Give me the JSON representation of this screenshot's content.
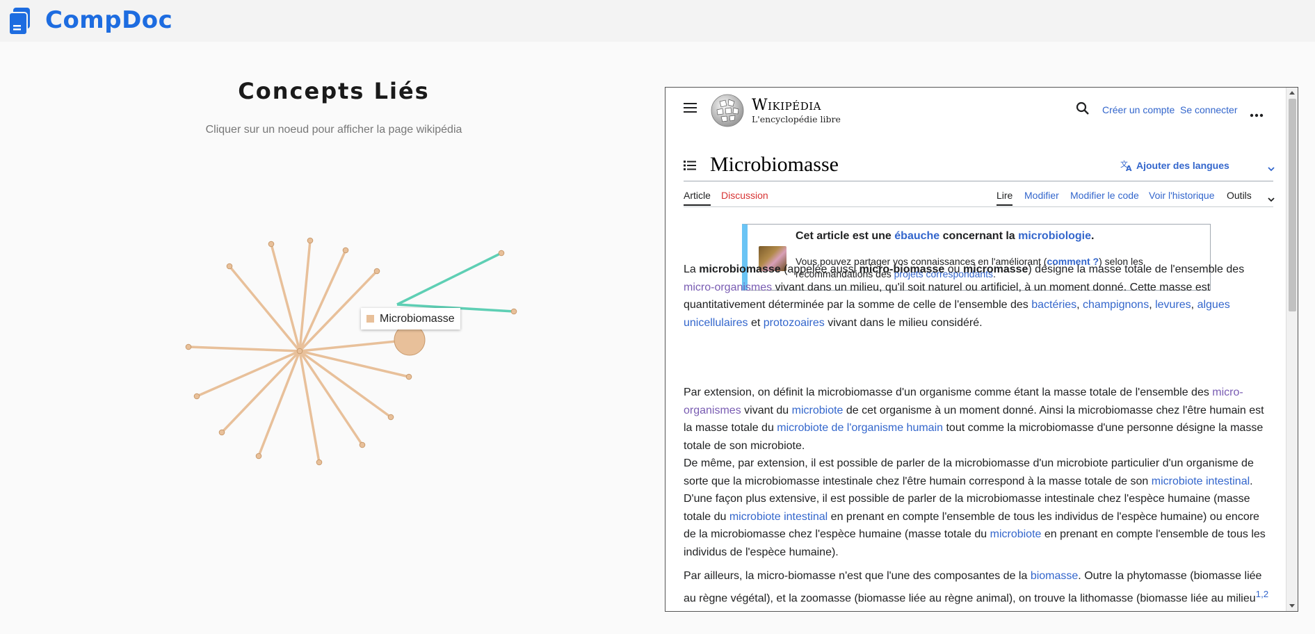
{
  "app": {
    "title": "CompDoc",
    "icon": "document-icon",
    "accent": "#1d6ce0"
  },
  "left": {
    "title": "Concepts Liés",
    "subtitle": "Cliquer sur un noeud pour afficher la page wikipédia",
    "tooltip": "Microbiomasse",
    "colors": {
      "node": "#e8c09a",
      "edge_main": "#e8c09a",
      "edge_selected": "#5ecfb4"
    }
  },
  "wiki": {
    "wordmark": "Wikipédia",
    "tagline": "L'encyclopédie libre",
    "create_account": "Créer un compte",
    "login": "Se connecter",
    "title": "Microbiomasse",
    "add_languages": "Ajouter des langues",
    "tabs": {
      "article": "Article",
      "discussion": "Discussion",
      "read": "Lire",
      "edit": "Modifier",
      "edit_code": "Modifier le code",
      "history": "Voir l'historique",
      "tools": "Outils"
    },
    "stub": {
      "pre": "Cet article est une ",
      "link1": "ébauche",
      "mid": " concernant la ",
      "link2": "microbiologie",
      "post": ".",
      "line2_pre": "Vous pouvez partager vos connaissances en l'améliorant (",
      "line2_link": "comment ?",
      "line2_mid": ") selon les recommandations des ",
      "line2_link2": "projets correspondants",
      "line2_post": "."
    },
    "p1": {
      "t1": "La ",
      "b1": "microbiomasse",
      "t2": " (appelée aussi ",
      "b2": "micro-biomasse",
      "t3": " ou ",
      "b3": "micromasse",
      "t4": ") désigne la masse totale de l'ensemble des ",
      "l1": "micro-organismes",
      "t5": " vivant dans un milieu, qu'il soit naturel ou artificiel, à un moment donné. Cette masse est quantitativement déterminée par la somme de celle de l'ensemble des ",
      "l2": "bactéries",
      "s1": ", ",
      "l3": "champignons",
      "s2": ", ",
      "l4": "levures",
      "s3": ", ",
      "l5": "algues unicellulaires",
      "t6": " et ",
      "l6": "protozoaires",
      "t7": " vivant dans le milieu considéré."
    },
    "p2": {
      "t1": "Par extension, on définit la microbiomasse d'un organisme comme étant la masse totale de l'ensemble des ",
      "l1": "micro-organismes",
      "t2": " vivant du ",
      "l2": "microbiote",
      "t3": " de cet organisme à un moment donné. Ainsi la microbiomasse chez l'être humain est la masse totale du ",
      "l3": "microbiote de l'organisme humain",
      "t4": " tout comme la microbiomasse d'une personne désigne la masse totale de son microbiote."
    },
    "p3": {
      "t1": "De même, par extension, il est possible de parler de la microbiomasse d'un microbiote particulier d'un organisme de sorte que la microbiomasse intestinale chez l'être humain correspond à la masse totale de son ",
      "l1": "microbiote intestinal",
      "t2": "."
    },
    "p4": {
      "t1": "D'une façon plus extensive, il est possible de parler de la microbiomasse intestinale chez l'espèce humaine (masse totale du ",
      "l1": "microbiote intestinal",
      "t2": " en prenant en compte l'ensemble de tous les individus de l'espèce humaine) ou encore de la microbiomasse chez l'espèce humaine (masse totale du ",
      "l2": "microbiote",
      "t3": " en prenant en compte l'ensemble de tous les individus de l'espèce humaine)."
    },
    "p5": {
      "t1": "Par ailleurs, la micro-biomasse n'est que l'une des composantes de la ",
      "l1": "biomasse",
      "t2": ". Outre la phytomasse (biomasse liée au règne végétal), et la zoomasse (biomasse liée au règne animal), on trouve la lithomasse (biomasse liée au milieu",
      "sup": "1,2"
    }
  }
}
